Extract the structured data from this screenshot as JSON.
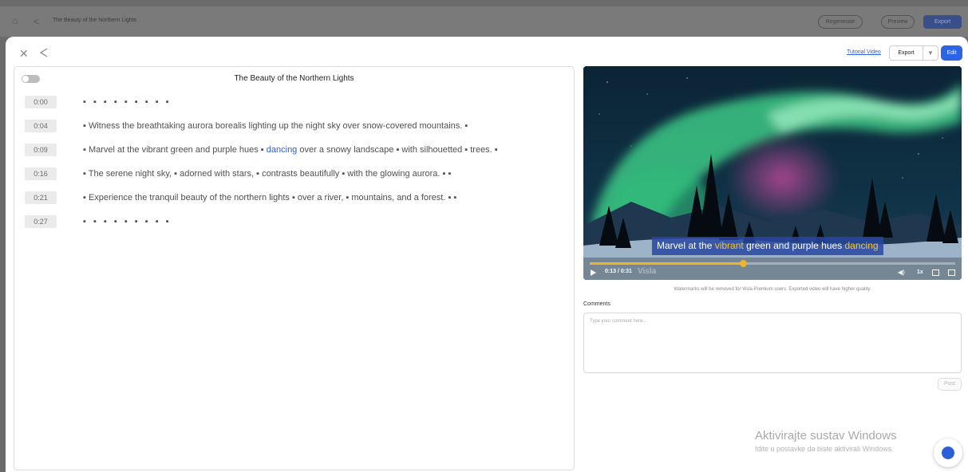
{
  "background": {
    "title": "The Beauty of the Northern Lights",
    "regenerate_label": "Regenerate",
    "preview_label": "Preview",
    "export_label": "Export"
  },
  "toolbar": {
    "tutorial_label": "Tutorial Video",
    "export_label": "Export",
    "edit_label": "Edit"
  },
  "script": {
    "title": "The Beauty of the Northern Lights",
    "rows": [
      {
        "time": "0:00",
        "text": "▪ ▪ ▪ ▪ ▪ ▪ ▪ ▪ ▪",
        "kind": "dots"
      },
      {
        "time": "0:04",
        "text": "▪ Witness the breathtaking aurora borealis lighting up the night sky over snow-covered mountains. ▪"
      },
      {
        "time": "0:09",
        "pre": "▪ Marvel at the vibrant green and purple hues ▪ ",
        "highlight": "dancing",
        "post": " over a snowy landscape ▪ with silhouetted ▪ trees. ▪"
      },
      {
        "time": "0:16",
        "text": "▪ The serene night sky, ▪ adorned with stars, ▪ contrasts beautifully ▪ with the glowing aurora. ▪ ▪"
      },
      {
        "time": "0:21",
        "text": "▪ Experience the tranquil beauty of the northern lights ▪ over a river, ▪ mountains, and a forest. ▪ ▪"
      },
      {
        "time": "0:27",
        "text": "▪ ▪ ▪ ▪ ▪ ▪ ▪ ▪ ▪",
        "kind": "dots"
      }
    ]
  },
  "player": {
    "caption_pre": "Marvel at the ",
    "caption_hl1": "vibrant",
    "caption_mid": " green and purple hues ",
    "caption_hl2": "dancing",
    "time": "0:13 / 0:31",
    "watermark": "Visla",
    "speed": "1x",
    "progress": 0.42,
    "accent_color": "#f0b429"
  },
  "watermark_note": "Watermarks will be removed for Visla Premium users. Exported video will have higher quality.",
  "comments": {
    "label": "Comments",
    "placeholder": "Type your comment here...",
    "post_label": "Post"
  },
  "windows_notice": {
    "title": "Aktivirajte sustav Windows",
    "subtitle": "Idite u postavke da biste aktivirali Windows."
  },
  "icons": [
    "home-icon",
    "share-icon",
    "close-icon",
    "chevron-down-icon",
    "play-icon",
    "volume-icon",
    "captions-icon",
    "fullscreen-icon",
    "help-icon"
  ]
}
